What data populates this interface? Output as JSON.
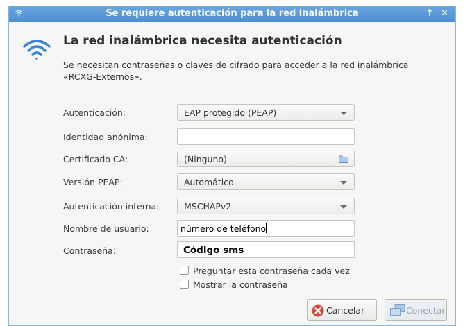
{
  "window": {
    "title": "Se requiere autenticación para la red inalámbrica",
    "controls": [
      "↑",
      "✕"
    ]
  },
  "dialog": {
    "heading": "La red inalámbrica necesita autenticación",
    "description_line1": "Se necesitan contraseñas o claves de cifrado para acceder a la red inalámbrica",
    "description_line2": "«RCXG-Externos»."
  },
  "form": {
    "authentication": {
      "label": "Autenticación:",
      "value": "EAP protegido (PEAP)"
    },
    "anonymous_identity": {
      "label": "Identidad anónima:",
      "value": ""
    },
    "ca_certificate": {
      "label": "Certificado CA:",
      "value": "(Ninguno)"
    },
    "peap_version": {
      "label": "Versión PEAP:",
      "value": "Automático"
    },
    "inner_auth": {
      "label": "Autenticación interna:",
      "value": "MSCHAPv2"
    },
    "username": {
      "label": "Nombre de usuario:",
      "value": "número de teléfono"
    },
    "password": {
      "label": "Contraseña:",
      "value": "Código sms"
    },
    "ask_password_check": "Preguntar esta contraseña cada vez",
    "show_password_check": "Mostrar la contraseña"
  },
  "buttons": {
    "cancel": "Cancelar",
    "connect": "Conectar"
  },
  "colors": {
    "titlebar": "#5a9ad7",
    "wifi_icon": "#3b86d6",
    "cancel_icon": "#d9453a"
  }
}
